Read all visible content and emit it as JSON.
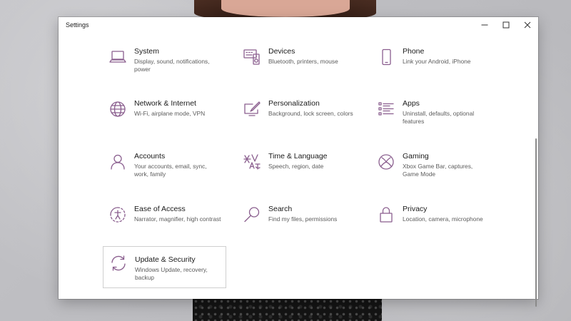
{
  "window": {
    "title": "Settings",
    "controls": {
      "minimize": "—",
      "maximize": "☐",
      "close": "✕"
    }
  },
  "categories": [
    {
      "name": "System",
      "desc": "Display, sound, notifications, power",
      "icon": "laptop-icon"
    },
    {
      "name": "Devices",
      "desc": "Bluetooth, printers, mouse",
      "icon": "keyboard-speaker-icon"
    },
    {
      "name": "Phone",
      "desc": "Link your Android, iPhone",
      "icon": "phone-icon"
    },
    {
      "name": "Network & Internet",
      "desc": "Wi-Fi, airplane mode, VPN",
      "icon": "globe-icon"
    },
    {
      "name": "Personalization",
      "desc": "Background, lock screen, colors",
      "icon": "paint-screen-icon"
    },
    {
      "name": "Apps",
      "desc": "Uninstall, defaults, optional features",
      "icon": "list-icon"
    },
    {
      "name": "Accounts",
      "desc": "Your accounts, email, sync, work, family",
      "icon": "person-icon"
    },
    {
      "name": "Time & Language",
      "desc": "Speech, region, date",
      "icon": "time-language-icon"
    },
    {
      "name": "Gaming",
      "desc": "Xbox Game Bar, captures, Game Mode",
      "icon": "xbox-icon"
    },
    {
      "name": "Ease of Access",
      "desc": "Narrator, magnifier, high contrast",
      "icon": "ease-of-access-icon"
    },
    {
      "name": "Search",
      "desc": "Find my files, permissions",
      "icon": "magnifier-icon"
    },
    {
      "name": "Privacy",
      "desc": "Location, camera, microphone",
      "icon": "lock-icon"
    },
    {
      "name": "Update & Security",
      "desc": "Windows Update, recovery, backup",
      "icon": "sync-icon"
    }
  ],
  "colors": {
    "accent": "#8a5e8e",
    "window_bg": "#ffffff",
    "text": "#1a1a1a",
    "subtext": "#5c5c5c"
  }
}
